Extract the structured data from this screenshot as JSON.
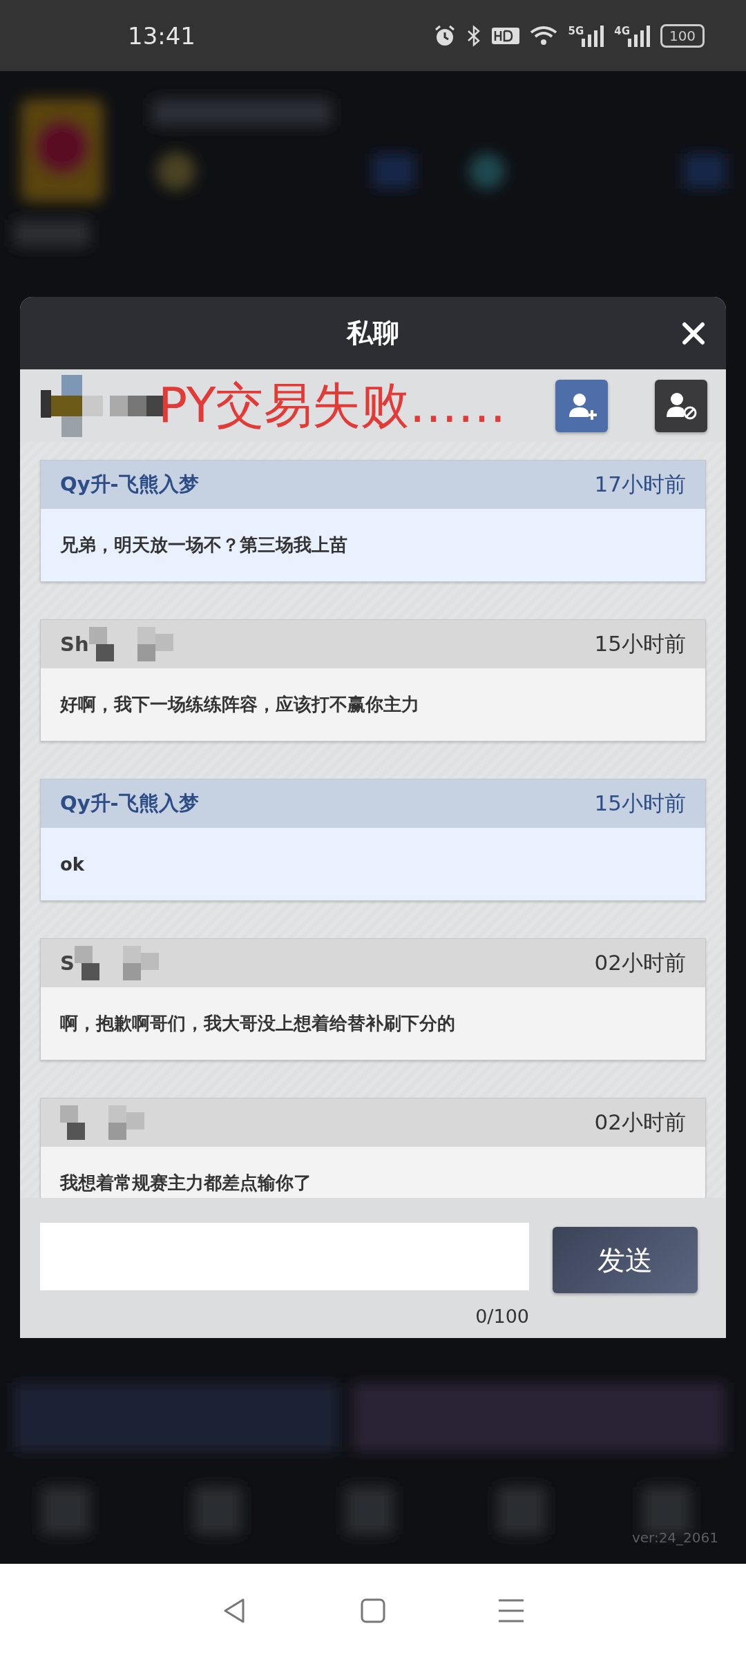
{
  "status_bar": {
    "time": "13:41",
    "battery": "100",
    "network_labels": [
      "5G",
      "4G"
    ]
  },
  "dialog": {
    "title": "私聊",
    "annotation": "PY交易失败……",
    "messages": [
      {
        "mine": true,
        "sender": "Qy升-飞熊入梦",
        "censored": false,
        "time": "17小时前",
        "text": "兄弟，明天放一场不？第三场我上苗"
      },
      {
        "mine": false,
        "sender": "Sh",
        "censored": true,
        "time": "15小时前",
        "text": "好啊，我下一场练练阵容，应该打不赢你主力"
      },
      {
        "mine": true,
        "sender": "Qy升-飞熊入梦",
        "censored": false,
        "time": "15小时前",
        "text": "ok"
      },
      {
        "mine": false,
        "sender": "S",
        "censored": true,
        "time": "02小时前",
        "text": "啊，抱歉啊哥们，我大哥没上想着给替补刷下分的"
      },
      {
        "mine": false,
        "censored": true,
        "time": "02小时前",
        "text": "我想着常规赛主力都差点输你了"
      }
    ],
    "send_button": "发送",
    "counter": "0/100"
  },
  "version": "ver:24_2061"
}
